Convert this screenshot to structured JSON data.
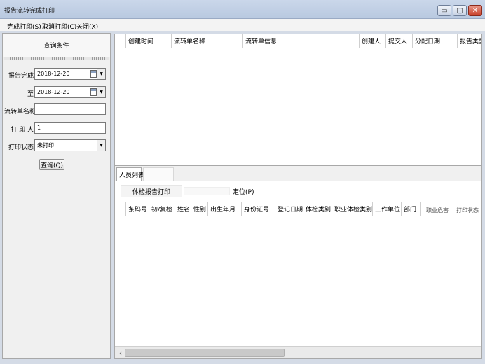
{
  "window": {
    "title": "报告流转完成打印",
    "controls": {
      "minimize": "▭",
      "maximize": "▢",
      "close": "✕"
    }
  },
  "menu": {
    "items": [
      {
        "label": "完成打印(S)"
      },
      {
        "label": "取消打印(C)"
      },
      {
        "label": "关闭(X)"
      }
    ]
  },
  "query_panel": {
    "title": "查询条件",
    "fields": {
      "report_done_label": "报告完成",
      "date_from": "2018-12-20",
      "to_label": "至",
      "date_to": "2018-12-20",
      "flow_name_label": "流转单名称",
      "flow_name_value": "",
      "printer_label": "打 印 人",
      "printer_value": "1",
      "print_status_label": "打印状态",
      "print_status_value": "未打印"
    },
    "query_button": "查询(Q)"
  },
  "top_grid": {
    "columns": [
      "创建时间",
      "流转单名称",
      "流转单信息",
      "创建人",
      "提交人",
      "分配日期",
      "报告类型"
    ]
  },
  "lower_panel": {
    "tabs": [
      {
        "label": "人员列表"
      }
    ],
    "sub_tabs": [
      {
        "label": "体检报告打印"
      }
    ],
    "locate_label": "定位(P)",
    "columns": [
      "条码号",
      "初/复检",
      "姓名",
      "性别",
      "出生年月",
      "身份证号",
      "登记日期",
      "体检类别",
      "职业体检类别",
      "工作单位",
      "部门",
      "职业危害",
      "打印状态"
    ]
  },
  "icons": {
    "calendar": "calendar-icon",
    "dropdown": "chevron-down-icon",
    "scroll_left": "chevron-left-icon"
  },
  "glyphs": {
    "dropdown": "▼",
    "scroll_left": "‹"
  },
  "colors": {
    "titlebar": "#c3d1e6",
    "close_button": "#c9402b",
    "panel_bg": "#f0f0f0"
  }
}
